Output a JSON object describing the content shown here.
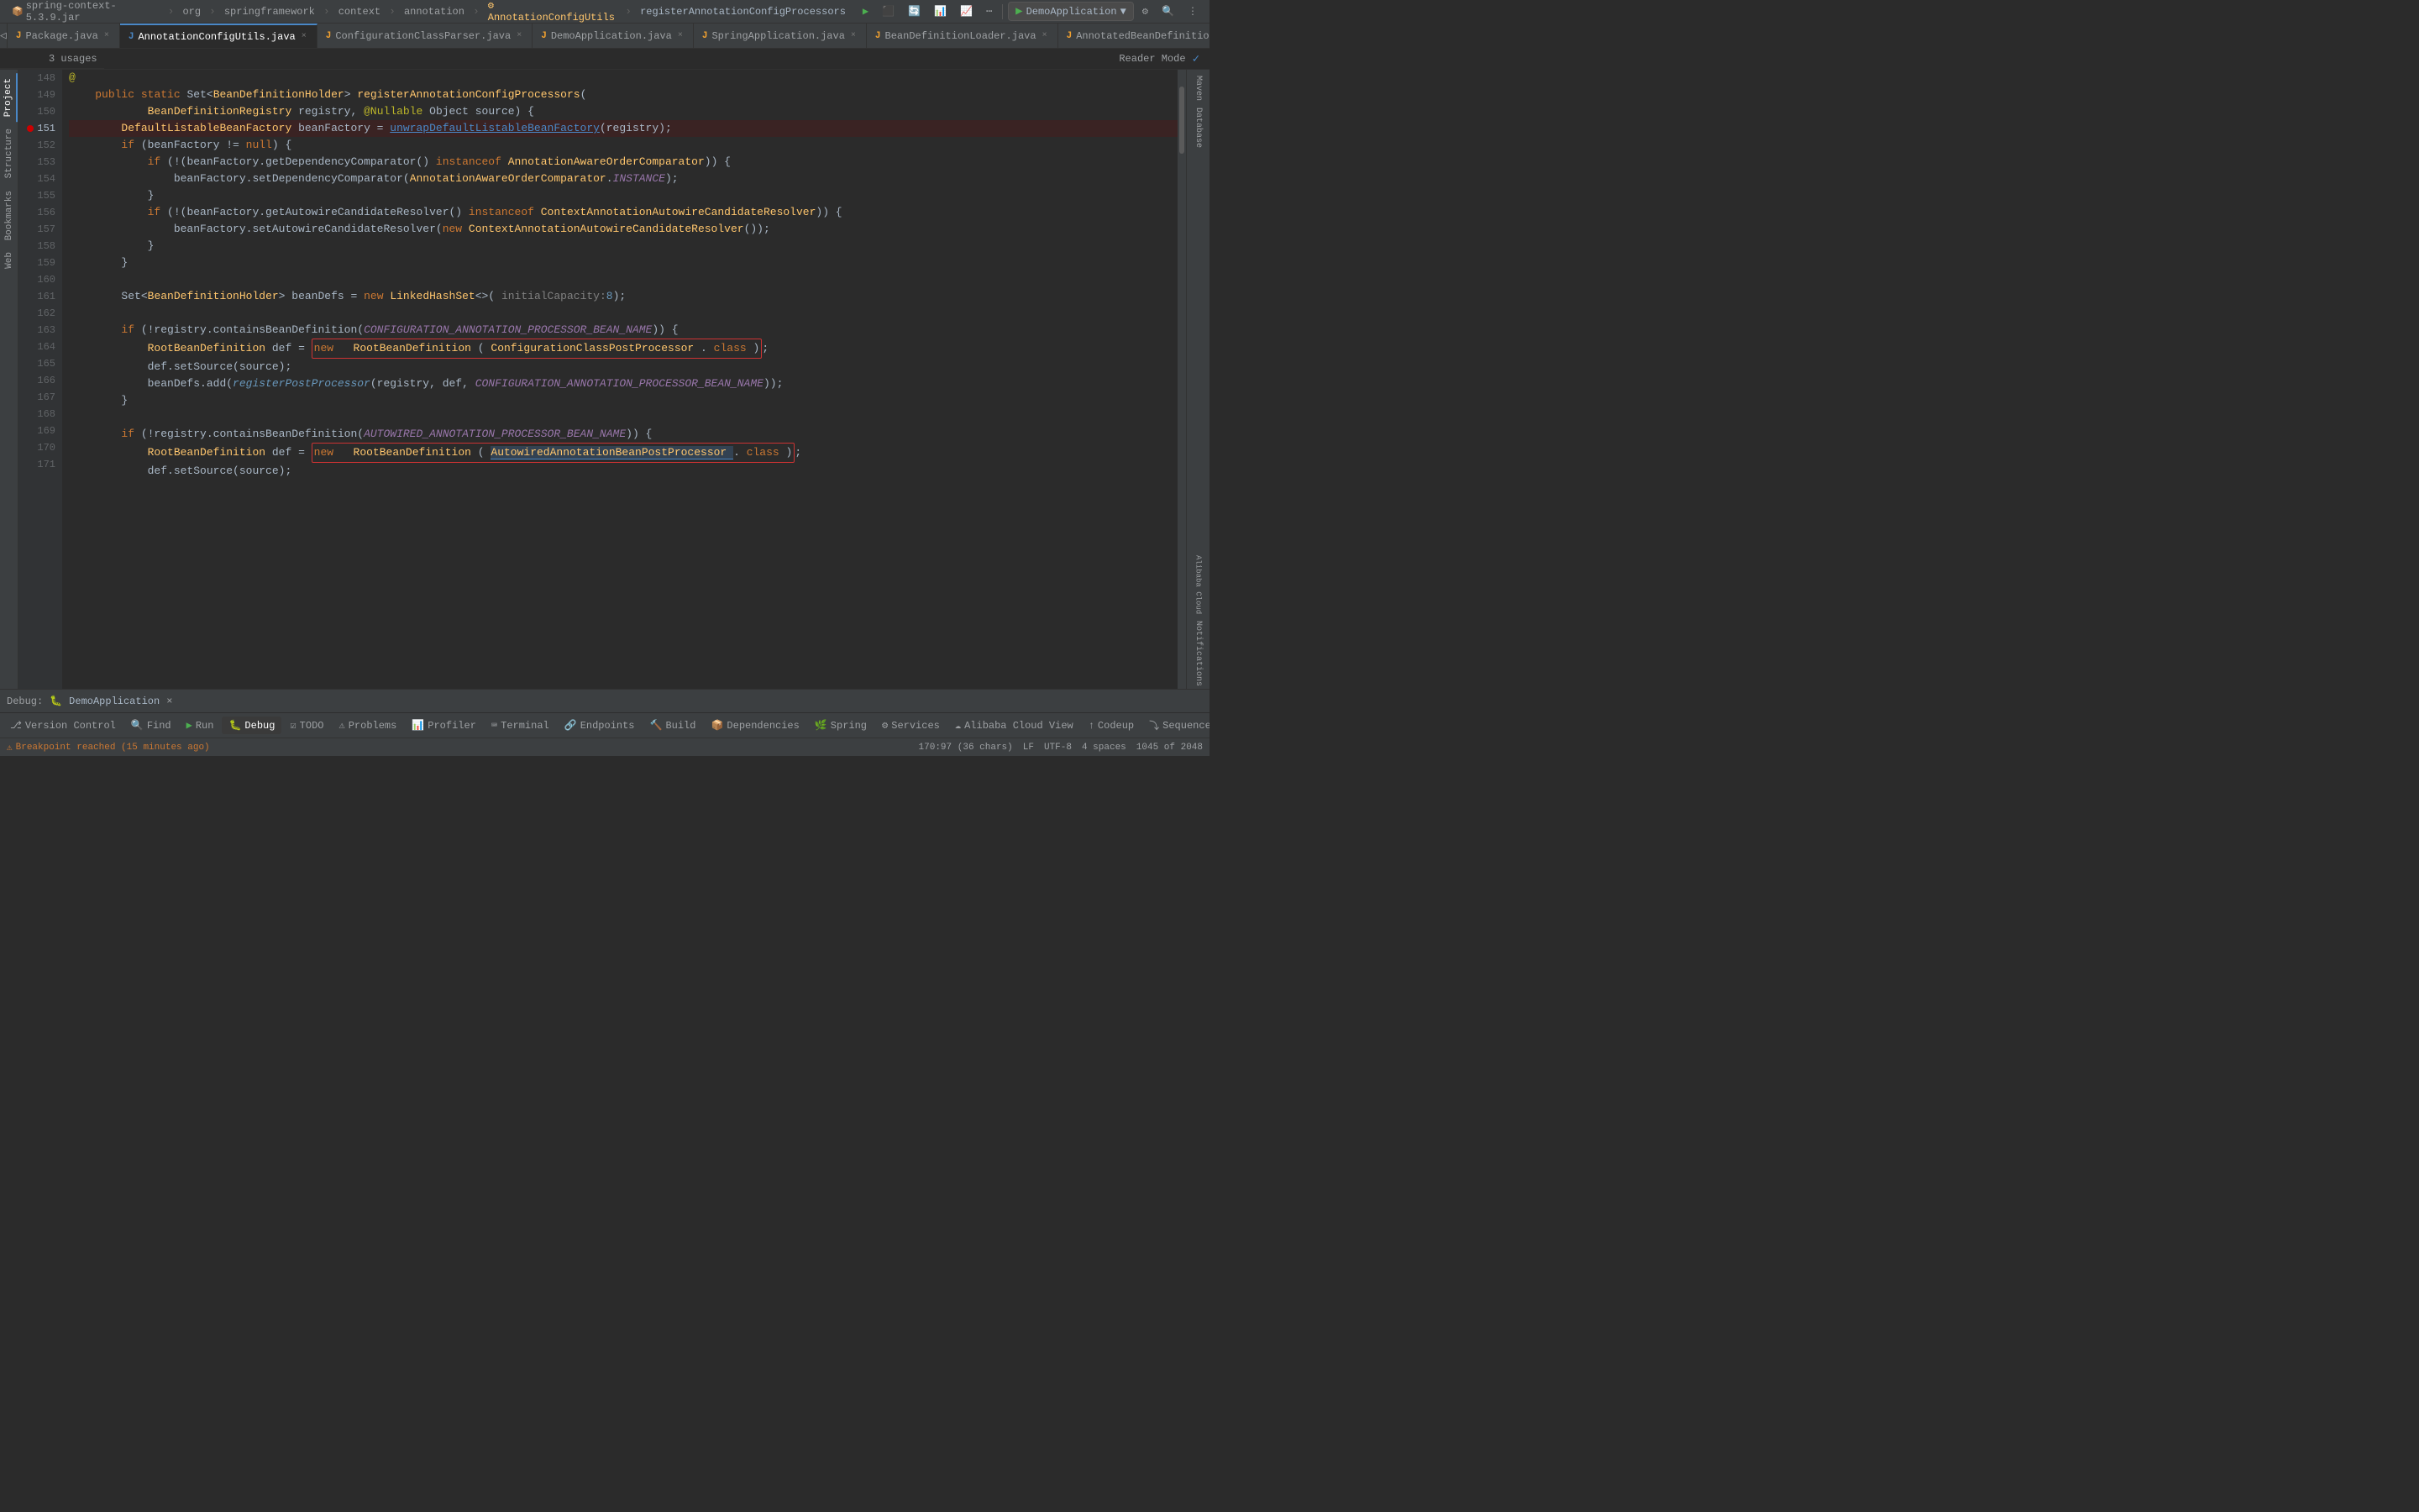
{
  "window": {
    "title": "spring-context-5.3.9.jar"
  },
  "breadcrumb": {
    "items": [
      {
        "label": "spring-context-5.3.9.jar",
        "icon": "jar"
      },
      {
        "label": "org",
        "icon": "package"
      },
      {
        "label": "springframework",
        "icon": "package"
      },
      {
        "label": "context",
        "icon": "package"
      },
      {
        "label": "annotation",
        "icon": "package"
      },
      {
        "label": "AnnotationConfigUtils",
        "icon": "class"
      },
      {
        "label": "registerAnnotationConfigProcessors",
        "icon": "method"
      }
    ],
    "separator": "›"
  },
  "tabs": [
    {
      "label": "Package.java",
      "active": false,
      "modified": false,
      "icon": "J"
    },
    {
      "label": "AnnotationConfigUtils.java",
      "active": true,
      "modified": false,
      "icon": "J"
    },
    {
      "label": "ConfigurationClassParser.java",
      "active": false,
      "modified": false,
      "icon": "J"
    },
    {
      "label": "DemoApplication.java",
      "active": false,
      "modified": false,
      "icon": "J"
    },
    {
      "label": "SpringApplication.java",
      "active": false,
      "modified": false,
      "icon": "J"
    },
    {
      "label": "BeanDefinitionLoader.java",
      "active": false,
      "modified": false,
      "icon": "J"
    },
    {
      "label": "AnnotatedBeanDefinitionReader.java",
      "active": false,
      "modified": false,
      "icon": "J"
    }
  ],
  "reader_mode": "Reader Mode",
  "usages": "3 usages",
  "code": {
    "lines": [
      {
        "num": 148,
        "indent": 0,
        "content": "@",
        "type": "annotation_marker"
      },
      {
        "num": 149,
        "content": "    public static Set<BeanDefinitionHolder> registerAnnotationConfigProcessors("
      },
      {
        "num": 150,
        "content": "            BeanDefinitionRegistry registry, @Nullable Object source) {"
      },
      {
        "num": 151,
        "content": "        DefaultListableBeanFactory beanFactory = unwrapDefaultListableBeanFactory(registry);",
        "breakpoint": true,
        "highlighted": true
      },
      {
        "num": 152,
        "content": "        if (beanFactory != null) {"
      },
      {
        "num": 153,
        "content": "            if (!(beanFactory.getDependencyComparator() instanceof AnnotationAwareOrderComparator)) {"
      },
      {
        "num": 154,
        "content": "                beanFactory.setDependencyComparator(AnnotationAwareOrderComparator.INSTANCE);"
      },
      {
        "num": 155,
        "content": "            }"
      },
      {
        "num": 156,
        "content": "            if (!(beanFactory.getAutowireCandidateResolver() instanceof ContextAnnotationAutowireCandidateResolver)) {"
      },
      {
        "num": 157,
        "content": "                beanFactory.setAutowireCandidateResolver(new ContextAnnotationAutowireCandidateResolver());"
      },
      {
        "num": 158,
        "content": "            }"
      },
      {
        "num": 159,
        "content": "        }"
      },
      {
        "num": 160,
        "content": ""
      },
      {
        "num": 161,
        "content": "        Set<BeanDefinitionHolder> beanDefs = new LinkedHashSet<>( initialCapacity: 8);"
      },
      {
        "num": 162,
        "content": ""
      },
      {
        "num": 163,
        "content": "        if (!registry.containsBeanDefinition(CONFIGURATION_ANNOTATION_PROCESSOR_BEAN_NAME)) {"
      },
      {
        "num": 164,
        "content": "            RootBeanDefinition def = new RootBeanDefinition(ConfigurationClassPostProcessor.class);",
        "box1": true
      },
      {
        "num": 165,
        "content": "            def.setSource(source);"
      },
      {
        "num": 166,
        "content": "            beanDefs.add(registerPostProcessor(registry, def, CONFIGURATION_ANNOTATION_PROCESSOR_BEAN_NAME));"
      },
      {
        "num": 167,
        "content": "        }"
      },
      {
        "num": 168,
        "content": ""
      },
      {
        "num": 169,
        "content": "        if (!registry.containsBeanDefinition(AUTOWIRED_ANNOTATION_PROCESSOR_BEAN_NAME)) {"
      },
      {
        "num": 170,
        "content": "            RootBeanDefinition def = new RootBeanDefinition(AutowiredAnnotationBeanPostProcessor.class);",
        "box2": true
      },
      {
        "num": 171,
        "content": "            def.setSource(source);"
      }
    ]
  },
  "toolbar": {
    "items": [
      {
        "label": "Version Control",
        "icon": "git"
      },
      {
        "label": "Find",
        "icon": "search"
      },
      {
        "label": "Run",
        "icon": "run"
      },
      {
        "label": "Debug",
        "icon": "debug",
        "active": true
      },
      {
        "label": "TODO",
        "icon": "todo"
      },
      {
        "label": "Problems",
        "icon": "problems"
      },
      {
        "label": "Profiler",
        "icon": "profiler"
      },
      {
        "label": "Terminal",
        "icon": "terminal"
      },
      {
        "label": "Endpoints",
        "icon": "endpoints"
      },
      {
        "label": "Build",
        "icon": "build"
      },
      {
        "label": "Dependencies",
        "icon": "dependencies"
      },
      {
        "label": "Spring",
        "icon": "spring"
      },
      {
        "label": "Services",
        "icon": "services"
      },
      {
        "label": "Alibaba Cloud View",
        "icon": "alibaba"
      },
      {
        "label": "Codeup",
        "icon": "codeup"
      },
      {
        "label": "Sequence",
        "icon": "sequence"
      }
    ]
  },
  "debug_bar": {
    "label": "Debug:",
    "app": "DemoApplication",
    "close_icon": "×"
  },
  "status_bar": {
    "position": "170:97 (36 chars)",
    "line_sep": "LF",
    "encoding": "UTF-8",
    "indent": "4 spaces",
    "lines_info": "1045 of 2048",
    "breakpoint_msg": "Breakpoint reached (15 minutes ago)"
  },
  "right_panels": [
    {
      "label": "Maven"
    },
    {
      "label": "Database"
    },
    {
      "label": "Alibaba Cloud"
    },
    {
      "label": "Notifications"
    }
  ],
  "left_panels": [
    {
      "label": "Project"
    },
    {
      "label": "Structure"
    },
    {
      "label": "Bookmarks"
    },
    {
      "label": "Web"
    }
  ],
  "app_selector": {
    "label": "DemoApplication",
    "icon": "▼"
  },
  "top_toolbar_buttons": [
    {
      "label": "▶",
      "title": "Run",
      "type": "run"
    },
    {
      "label": "⬛",
      "title": "Stop"
    },
    {
      "label": "🔄",
      "title": "Reload"
    },
    {
      "label": "⚙",
      "title": "Settings"
    }
  ]
}
